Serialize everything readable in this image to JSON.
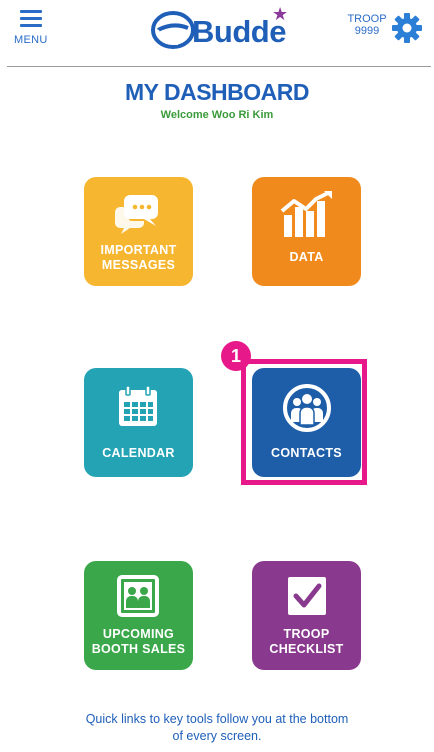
{
  "header": {
    "menu_label": "MENU",
    "logo_text": "Budde",
    "troop_label_line1": "TROOP",
    "troop_label_line2": "9999"
  },
  "dashboard": {
    "title": "MY DASHBOARD",
    "welcome": "Welcome Woo Ri Kim"
  },
  "tiles": [
    {
      "id": "messages",
      "label_line1": "IMPORTANT",
      "label_line2": "MESSAGES",
      "color": "#f6b62f",
      "icon": "speech-bubbles-icon"
    },
    {
      "id": "data",
      "label_line1": "DATA",
      "label_line2": "",
      "color": "#f08a1c",
      "icon": "chart-icon"
    },
    {
      "id": "calendar",
      "label_line1": "CALENDAR",
      "label_line2": "",
      "color": "#23a3b3",
      "icon": "calendar-icon"
    },
    {
      "id": "contacts",
      "label_line1": "CONTACTS",
      "label_line2": "",
      "color": "#1e5ea8",
      "icon": "people-icon"
    },
    {
      "id": "booth",
      "label_line1": "UPCOMING",
      "label_line2": "BOOTH SALES",
      "color": "#3aa84a",
      "icon": "booth-icon"
    },
    {
      "id": "checklist",
      "label_line1": "TROOP",
      "label_line2": "CHECKLIST",
      "color": "#8a3a8e",
      "icon": "checklist-icon"
    }
  ],
  "callout": {
    "number": "1",
    "color": "#e6188a"
  },
  "footer": {
    "line1": "Quick links to key tools follow you at the bottom",
    "line2": "of every screen."
  }
}
